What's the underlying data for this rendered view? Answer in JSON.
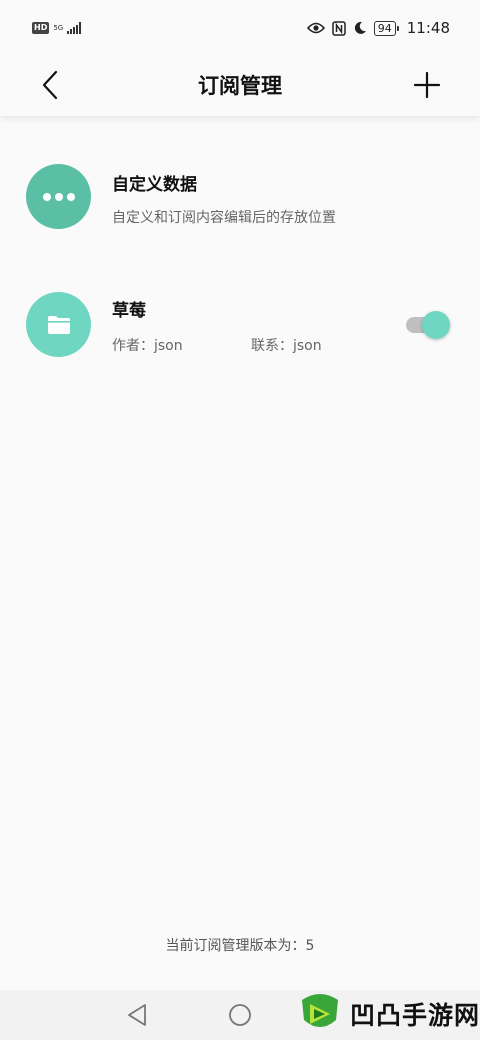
{
  "status_bar": {
    "hd": "HD",
    "network": "5G",
    "time": "11:48",
    "battery": "94"
  },
  "header": {
    "title": "订阅管理",
    "back_icon": "chevron-left-icon",
    "add_icon": "plus-icon"
  },
  "items": [
    {
      "title": "自定义数据",
      "subtitle": "自定义和订阅内容编辑后的存放位置",
      "icon": "more-dots-icon",
      "color": "#5bbfa6"
    },
    {
      "title": "草莓",
      "author": "作者：json",
      "contact": "联系：json",
      "icon": "folder-icon",
      "color": "#6ed6c1",
      "enabled": true
    }
  ],
  "footer": {
    "version_text": "当前订阅管理版本为：5"
  },
  "watermark": {
    "text": "凹凸手游网"
  }
}
